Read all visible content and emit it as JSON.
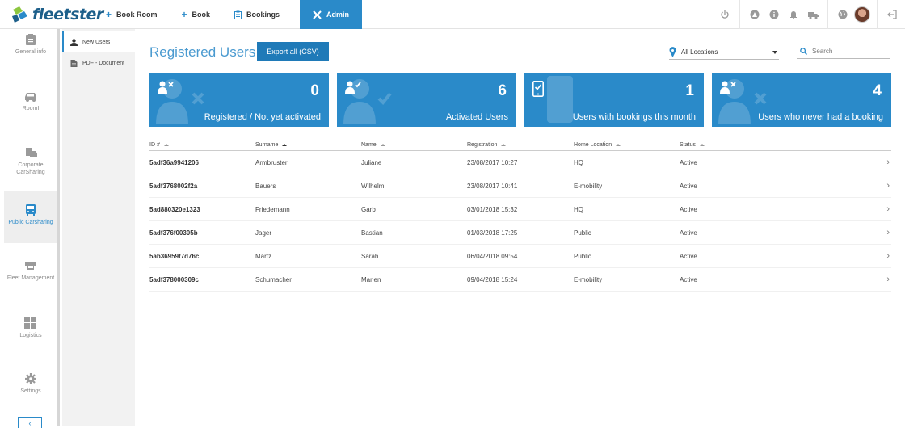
{
  "brand": {
    "name": "fleetster"
  },
  "nav": [
    {
      "label": "Book Room",
      "icon": "plus-icon"
    },
    {
      "label": "Book",
      "icon": "plus-icon"
    },
    {
      "label": "Bookings",
      "icon": "clipboard-icon"
    },
    {
      "label": "Admin",
      "icon": "tools-icon",
      "active": true
    }
  ],
  "top_icons": [
    "power-icon",
    "warning-icon",
    "info-icon",
    "bell-icon",
    "truck-icon",
    "globe-icon",
    "avatar",
    "logout-icon"
  ],
  "sidebar": [
    {
      "label": "General info",
      "icon": "info-doc-icon"
    },
    {
      "label": "RoomI",
      "icon": "car-icon"
    },
    {
      "label": "Corporate CarSharing",
      "icon": "building-car-icon"
    },
    {
      "label": "Public Carsharing",
      "icon": "bus-icon",
      "active": true
    },
    {
      "label": "Fleet Management",
      "icon": "fleet-icon"
    },
    {
      "label": "Logistics",
      "icon": "boxes-icon"
    },
    {
      "label": "Settings",
      "icon": "gear-icon"
    }
  ],
  "subnav": [
    {
      "label": "New Users",
      "icon": "user-icon",
      "active": true
    },
    {
      "label": "PDF - Document",
      "icon": "document-icon"
    }
  ],
  "main": {
    "title": "Registered Users",
    "export_label": "Export all (CSV)",
    "location": "All Locations",
    "search_placeholder": "Search"
  },
  "cards": [
    {
      "value": "0",
      "label": "Registered / Not yet activated",
      "icon": "user-x-icon"
    },
    {
      "value": "6",
      "label": "Activated Users",
      "icon": "user-check-icon"
    },
    {
      "value": "1",
      "label": "Users with bookings this month",
      "icon": "phone-check-icon"
    },
    {
      "value": "4",
      "label": "Users who never had a booking",
      "icon": "user-x-icon"
    }
  ],
  "table": {
    "columns": [
      "ID #",
      "Surname",
      "Name",
      "Registration",
      "Home Location",
      "Status"
    ],
    "rows": [
      [
        "5adf36a9941206",
        "Armbruster",
        "Juliane",
        "23/08/2017 10:27",
        "HQ",
        "Active"
      ],
      [
        "5adf3768002f2a",
        "Bauers",
        "Wilhelm",
        "23/08/2017 10:41",
        "E-mobility",
        "Active"
      ],
      [
        "5ad880320e1323",
        "Friedemann",
        "Garb",
        "03/01/2018 15:32",
        "HQ",
        "Active"
      ],
      [
        "5adf376f00305b",
        "Jager",
        "Bastian",
        "01/03/2018 17:25",
        "Public",
        "Active"
      ],
      [
        "5ab36959f7d76c",
        "Martz",
        "Sarah",
        "06/04/2018 09:54",
        "Public",
        "Active"
      ],
      [
        "5adf378000309c",
        "Schumacher",
        "Marlen",
        "09/04/2018 15:24",
        "E-mobility",
        "Active"
      ]
    ]
  },
  "colors": {
    "accent": "#2a8ac9",
    "title": "#4a9ad0",
    "button": "#1f7ab8"
  }
}
